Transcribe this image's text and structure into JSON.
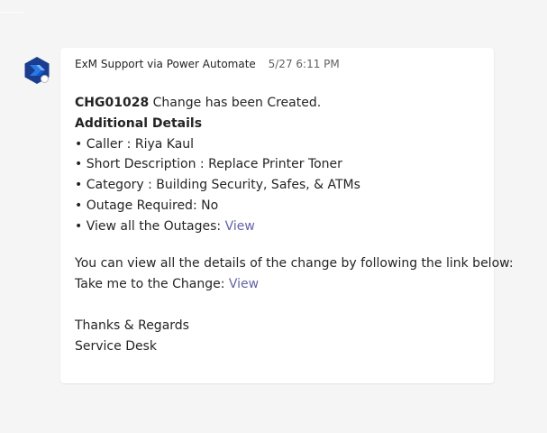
{
  "message": {
    "sender": "ExM Support via Power Automate",
    "timestamp": "5/27 6:11 PM",
    "avatar_icon": "power-automate-icon",
    "change_id": "CHG01028",
    "created_text": " Change has been Created.",
    "details_heading": "Additional Details",
    "details": [
      {
        "bullet": "•",
        "label": "Caller : ",
        "value": "Riya Kaul"
      },
      {
        "bullet": "•",
        "label": "Short Description : ",
        "value": "Replace Printer Toner"
      },
      {
        "bullet": "•",
        "label": "Category : ",
        "value": "Building Security, Safes, & ATMs"
      },
      {
        "bullet": "•",
        "label": "Outage Required: ",
        "value": "No"
      }
    ],
    "outages": {
      "bullet": "•",
      "label": "View all the Outages: ",
      "link": "View"
    },
    "info_text": "You can view all the details of the change by following the link below:",
    "change_link": {
      "label": "Take me to the Change: ",
      "link": "View"
    },
    "signoff": "Thanks & Regards",
    "team": "Service Desk"
  },
  "colors": {
    "background": "#f5f5f5",
    "card": "#ffffff",
    "link": "#6264a7",
    "text": "#242424",
    "muted": "#616161",
    "avatar_navy": "#1b3d8f",
    "avatar_blue": "#2a7ae2"
  }
}
